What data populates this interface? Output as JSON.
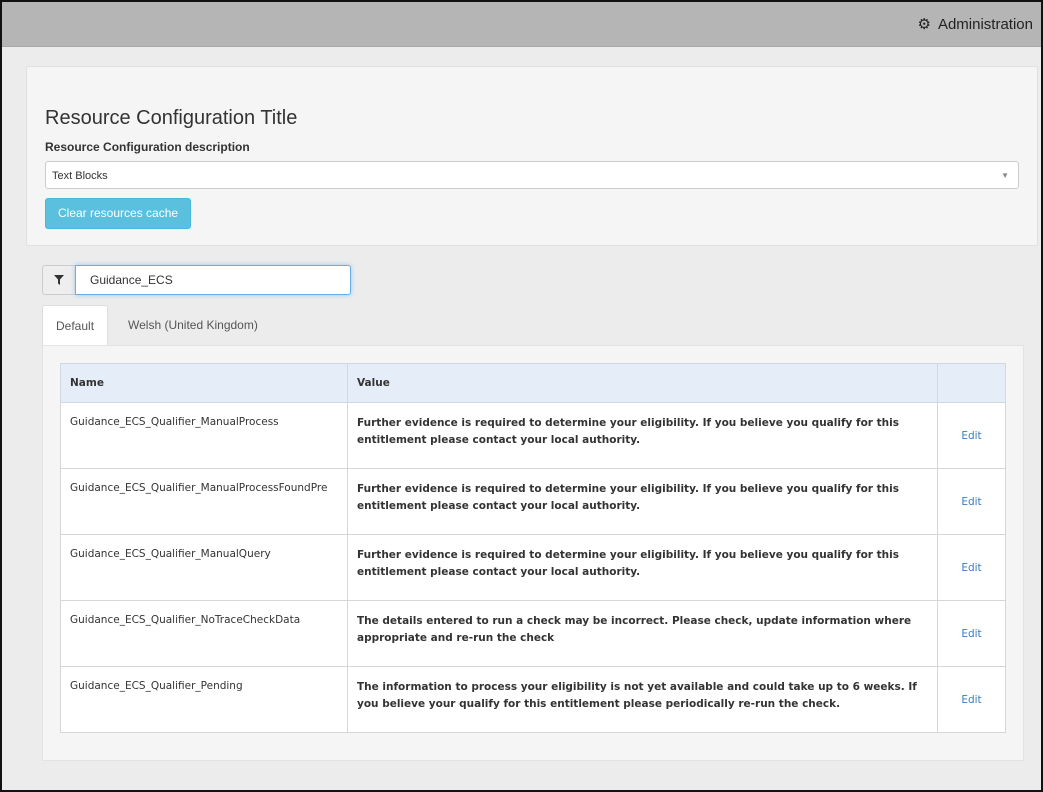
{
  "topbar": {
    "admin_label": "Administration",
    "admin_icon": "gear-icon"
  },
  "config": {
    "title": "Resource Configuration Title",
    "description_label": "Resource Configuration description",
    "selected_option": "Text Blocks",
    "clear_button": "Clear resources cache"
  },
  "filter": {
    "value": "Guidance_ECS",
    "icon": "filter-icon"
  },
  "tabs": [
    {
      "label": "Default",
      "active": true
    },
    {
      "label": "Welsh (United Kingdom)",
      "active": false
    }
  ],
  "table": {
    "headers": {
      "name": "Name",
      "value": "Value",
      "action": ""
    },
    "rows": [
      {
        "name": "Guidance_ECS_Qualifier_ManualProcess",
        "value": "Further evidence is required to determine your eligibility. If you believe you qualify for this entitlement please contact your local authority.",
        "action": "Edit"
      },
      {
        "name": "Guidance_ECS_Qualifier_ManualProcessFoundPre",
        "value": "Further evidence is required to determine your eligibility. If you believe you qualify for this entitlement please contact your local authority.",
        "action": "Edit"
      },
      {
        "name": "Guidance_ECS_Qualifier_ManualQuery",
        "value": "Further evidence is required to determine your eligibility. If you believe you qualify for this entitlement please contact your local authority.",
        "action": "Edit"
      },
      {
        "name": "Guidance_ECS_Qualifier_NoTraceCheckData",
        "value": "The details entered to run a check may be incorrect. Please check, update information where appropriate and re-run the check",
        "action": "Edit"
      },
      {
        "name": "Guidance_ECS_Qualifier_Pending",
        "value": "The information to process your eligibility is not yet available and could take up to 6 weeks. If you believe your qualify for this entitlement please periodically re-run the check.",
        "action": "Edit"
      }
    ]
  },
  "colors": {
    "topbar": "#b5b5b5",
    "accent_button": "#5bc0de",
    "link": "#3a7cc0",
    "table_header": "#e4edf8"
  }
}
